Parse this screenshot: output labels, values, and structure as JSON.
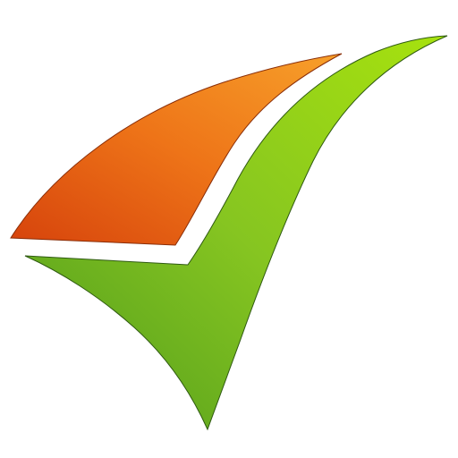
{
  "logo": {
    "icon": "checkmark-swoosh-icon",
    "colors": {
      "orange_light": "#f7a02a",
      "orange_mid": "#ee7418",
      "orange_dark": "#d6430c",
      "green_light": "#a7e20e",
      "green_mid": "#86c521",
      "green_dark": "#4f9a1c",
      "outline": "#2f5a12",
      "background": "#ffffff"
    }
  }
}
